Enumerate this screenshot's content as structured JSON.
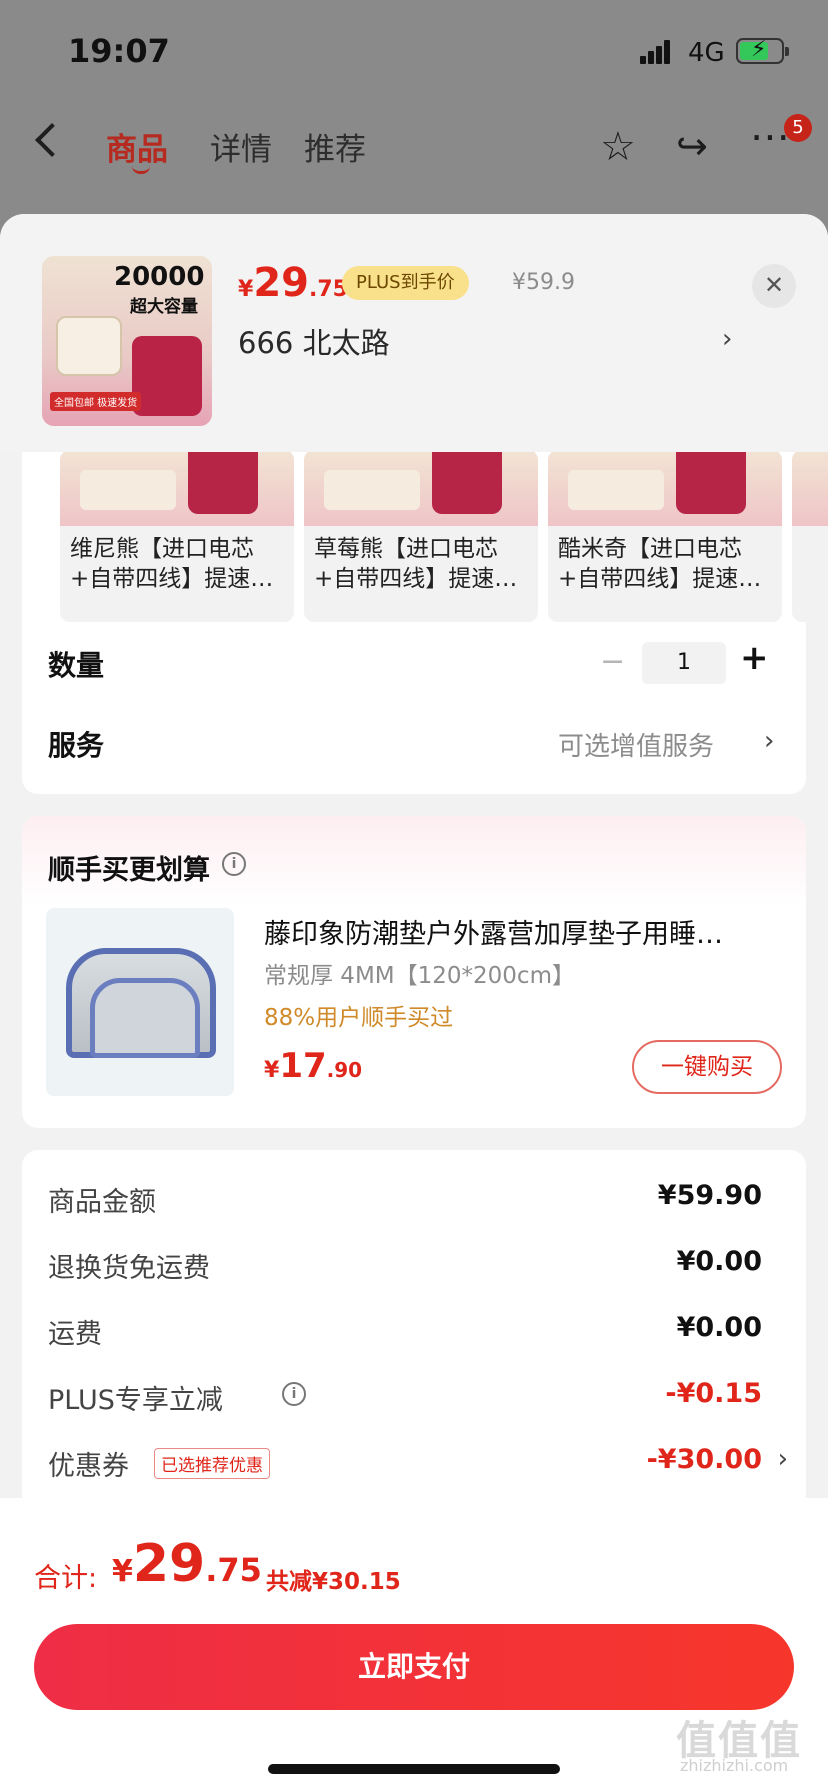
{
  "status_bar": {
    "time": "19:07",
    "network": "4G"
  },
  "nav": {
    "tabs": [
      {
        "label": "商品",
        "active": true
      },
      {
        "label": "详情",
        "active": false
      },
      {
        "label": "推荐",
        "active": false
      }
    ],
    "badge_count": "5",
    "icons": [
      "back-icon",
      "star-icon",
      "share-icon",
      "more-icon"
    ]
  },
  "product": {
    "thumb_text": {
      "capacity": "20000",
      "capacity_sub": "超大容量",
      "tag": "全国包邮 极速发货"
    },
    "price": {
      "symbol": "¥",
      "int": "29",
      "dec": ".75"
    },
    "plus_tag": "PLUS到手价",
    "original_price": "¥59.9",
    "address": "666  北太路"
  },
  "variants": [
    {
      "line1": "维尼熊【进口电芯",
      "line2": "+自带四线】提速…"
    },
    {
      "line1": "草莓熊【进口电芯",
      "line2": "+自带四线】提速…"
    },
    {
      "line1": "酷米奇【进口电芯",
      "line2": "+自带四线】提速…"
    }
  ],
  "quantity": {
    "label": "数量",
    "value": "1",
    "minus": "−",
    "plus": "+"
  },
  "service": {
    "label": "服务",
    "value": "可选增值服务"
  },
  "recommend": {
    "title": "顺手买更划算",
    "name": "藤印象防潮垫户外露营加厚垫子用睡…",
    "spec": "常规厚 4MM【120*200cm】",
    "users": "88%用户顺手买过",
    "price": {
      "symbol": "¥",
      "int": "17",
      "dec": ".90"
    },
    "buy_label": "一键购买"
  },
  "summary": [
    {
      "label": "商品金额",
      "value": "¥59.90",
      "red": false
    },
    {
      "label": "退换货免运费",
      "value": "¥0.00",
      "red": false
    },
    {
      "label": "运费",
      "value": "¥0.00",
      "red": false
    },
    {
      "label": "PLUS专享立减",
      "value": "-¥0.15",
      "red": true
    },
    {
      "label": "优惠券",
      "value": "-¥30.00",
      "red": true,
      "tag": "已选推荐优惠"
    }
  ],
  "total": {
    "label": "合计:",
    "price": {
      "symbol": "¥",
      "int": "29",
      "dec": ".75"
    },
    "saved": "共减¥30.15"
  },
  "pay_button": "立即支付",
  "watermark": {
    "main": "值值值",
    "sub": "zhizhizhi.com"
  },
  "colors": {
    "accent": "#e0261a",
    "plus_tag_bg": "#f9e08a",
    "sheet_bg": "#f2f2f2",
    "overlay": "#8a8a8a"
  }
}
